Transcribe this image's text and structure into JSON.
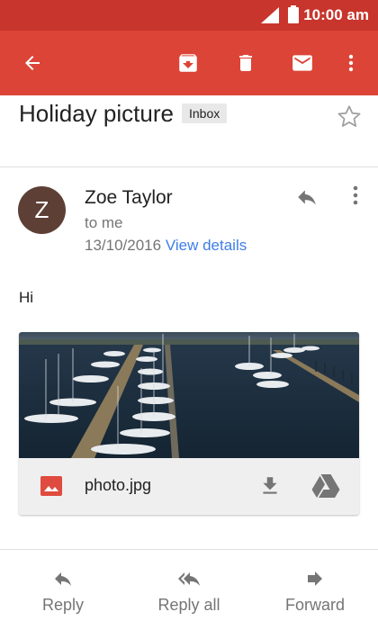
{
  "status_bar": {
    "time": "10:00 am"
  },
  "app_bar": {
    "back_icon": "arrow-back-icon",
    "archive_icon": "archive-icon",
    "delete_icon": "delete-icon",
    "mark_unread_icon": "mail-icon",
    "more_icon": "more-vert-icon"
  },
  "message": {
    "subject": "Holiday picture",
    "label": "Inbox",
    "sender": {
      "initial": "Z",
      "name": "Zoe Taylor",
      "recipient": "to me",
      "date": "13/10/2016",
      "view_details": "View details"
    },
    "body": "Hi",
    "attachment": {
      "file_name": "photo.jpg"
    }
  },
  "actions": {
    "reply": "Reply",
    "reply_all": "Reply all",
    "forward": "Forward"
  },
  "colors": {
    "status_bar": "#c8352c",
    "app_bar": "#dc4437",
    "avatar": "#5d3f36",
    "link": "#3e7ee8",
    "image_icon": "#e04b3f"
  }
}
